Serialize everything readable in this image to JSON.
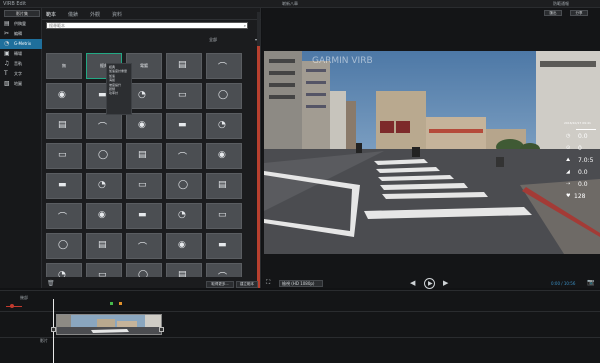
{
  "app": {
    "title": "VIRB Edit"
  },
  "titlebar": {
    "center_label": "嶄新八章",
    "right_label": "防範通報"
  },
  "nav": {
    "header": "影片集",
    "items": [
      {
        "label": "供稿靈",
        "icon": "film-icon"
      },
      {
        "label": "編輯",
        "icon": "scissors-icon"
      },
      {
        "label": "G-Metrix",
        "icon": "gauge-icon",
        "active": true
      },
      {
        "label": "轉場",
        "icon": "transition-icon"
      },
      {
        "label": "音軌",
        "icon": "music-icon"
      },
      {
        "label": "文字",
        "icon": "text-icon"
      },
      {
        "label": "地圖",
        "icon": "map-icon"
      }
    ]
  },
  "gallery": {
    "tabs": [
      "範本",
      "儀錶",
      "外觀",
      "資料"
    ],
    "search_placeholder": "搜尋範本",
    "filter_label": "全部",
    "tiles": [
      "無",
      "經典",
      "電鍍",
      "",
      "",
      "",
      "",
      "",
      "",
      "",
      "",
      "",
      "",
      "",
      "",
      "",
      "",
      "",
      "",
      "",
      "",
      "",
      "",
      "",
      "",
      "",
      "",
      "",
      "",
      "",
      "",
      "",
      "",
      "",
      "",
      "",
      "",
      "",
      "",
      "",
      "",
      "",
      "",
      "",
      ""
    ],
    "context_menu": [
      "經典",
      "加速度計重量",
      "加速",
      "海拔",
      "坡度提升",
      "踏頻",
      "功率計"
    ],
    "buttons": {
      "get_more": "取得更多...",
      "create": "建立範本"
    }
  },
  "preview": {
    "top_buttons": [
      "匯出",
      "分享"
    ],
    "quality_label": "檢視 (HD 1080p)",
    "timecode": "0:00 / 10:56",
    "overlay_values": [
      "0.0",
      "0",
      "7.0:5",
      "0.0",
      "0.0",
      "128"
    ],
    "overlay_units": [
      "km/h",
      "G",
      "m",
      "%",
      "km",
      "BPM"
    ]
  },
  "timeline": {
    "track_label_top": "幾部",
    "track_label_bottom": "影片"
  }
}
